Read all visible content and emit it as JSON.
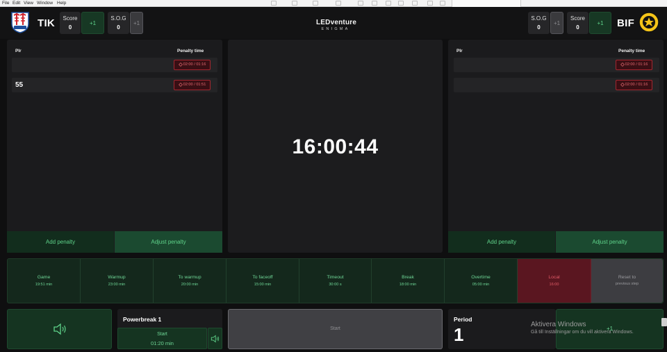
{
  "menu": [
    "File",
    "Edit",
    "View",
    "Window",
    "Help"
  ],
  "brand": {
    "name": "LEDventure",
    "sub": "ENIGMA"
  },
  "home": {
    "abbr": "TIK",
    "crest_text": "1955",
    "score_label": "Score",
    "score": "0",
    "sog_label": "S.O.G",
    "sog": "0",
    "plus": "+1"
  },
  "away": {
    "abbr": "BIF",
    "score_label": "Score",
    "score": "0",
    "sog_label": "S.O.G",
    "sog": "0",
    "plus": "+1"
  },
  "penalties_home": {
    "col_player": "Plr",
    "col_time": "Penalty time",
    "rows": [
      {
        "player": "",
        "time": "02:00 / 01:16"
      },
      {
        "player": "55",
        "time": "02:00 / 01:51"
      }
    ],
    "add": "Add penalty",
    "adjust": "Adjust penalty"
  },
  "penalties_away": {
    "col_player": "Plr",
    "col_time": "Penalty time",
    "rows": [
      {
        "player": "",
        "time": "02:00 / 01:16"
      },
      {
        "player": "",
        "time": "02:00 / 01:16"
      }
    ],
    "add": "Add penalty",
    "adjust": "Adjust penalty"
  },
  "clock": "16:00:44",
  "modes": [
    {
      "name": "Game",
      "time": "19:51 min"
    },
    {
      "name": "Warmup",
      "time": "23:00 min"
    },
    {
      "name": "To warmup",
      "time": "20:00 min"
    },
    {
      "name": "To faceoff",
      "time": "15:00 min"
    },
    {
      "name": "Timeout",
      "time": "30:00 s"
    },
    {
      "name": "Break",
      "time": "18:00 min"
    },
    {
      "name": "Overtime",
      "time": "05:00 min"
    },
    {
      "name": "Local",
      "time": "16:00"
    },
    {
      "name": "Reset to",
      "time": "previous step"
    }
  ],
  "powerbreak": {
    "title": "Powerbreak 1",
    "start": "Start",
    "time": "01:20 min"
  },
  "start": "Start",
  "period": {
    "label": "Period",
    "value": "1",
    "plus": "+1"
  },
  "activate": {
    "title": "Aktivera Windows",
    "text": "Gå till Inställningar om du vill aktivera Windows."
  },
  "colors": {
    "accent_green": "#5fd38a",
    "penalty_red": "#e56a72",
    "local_red": "#5a1620"
  }
}
